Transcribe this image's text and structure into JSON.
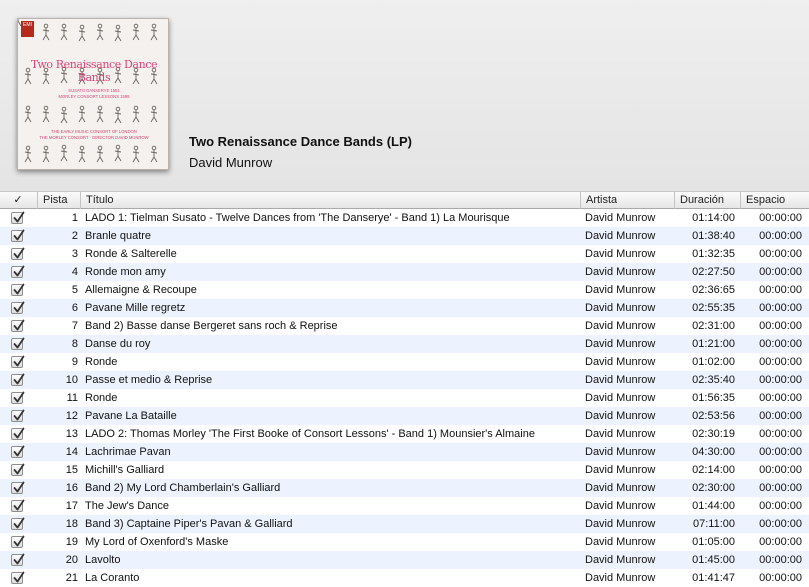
{
  "album": {
    "title": "Two Renaissance Dance Bands (LP)",
    "artist": "David Munrow",
    "cover": {
      "logo": "EMI",
      "title": "Two Renaissance Dance Bands",
      "credit_line_1": "SUSATO DANSERYE 1551",
      "credit_line_2": "MORLEY CONSORT LESSONS 1599",
      "credit_line_3": "THE EARLY MUSIC CONSORT OF LONDON",
      "credit_line_4": "THE MORLEY CONSORT · DIRECTOR DAVID MUNROW"
    }
  },
  "columns": {
    "check": "✓",
    "track": "Pista",
    "title": "Título",
    "artist": "Artista",
    "duration": "Duración",
    "space": "Espacio"
  },
  "tracks": [
    {
      "num": "1",
      "title": "LADO 1: Tielman Susato - Twelve Dances from 'The Danserye' - Band 1) La Mourisque",
      "artist": "David Munrow",
      "duration": "01:14:00",
      "space": "00:00:00",
      "checked": true
    },
    {
      "num": "2",
      "title": "Branle quatre",
      "artist": "David Munrow",
      "duration": "01:38:40",
      "space": "00:00:00",
      "checked": true
    },
    {
      "num": "3",
      "title": "Ronde & Salterelle",
      "artist": "David Munrow",
      "duration": "01:32:35",
      "space": "00:00:00",
      "checked": true
    },
    {
      "num": "4",
      "title": "Ronde mon amy",
      "artist": "David Munrow",
      "duration": "02:27:50",
      "space": "00:00:00",
      "checked": true
    },
    {
      "num": "5",
      "title": "Allemaigne & Recoupe",
      "artist": "David Munrow",
      "duration": "02:36:65",
      "space": "00:00:00",
      "checked": true
    },
    {
      "num": "6",
      "title": "Pavane Mille regretz",
      "artist": "David Munrow",
      "duration": "02:55:35",
      "space": "00:00:00",
      "checked": true
    },
    {
      "num": "7",
      "title": "Band 2) Basse danse Bergeret sans roch & Reprise",
      "artist": "David Munrow",
      "duration": "02:31:00",
      "space": "00:00:00",
      "checked": true
    },
    {
      "num": "8",
      "title": "Danse du roy",
      "artist": "David Munrow",
      "duration": "01:21:00",
      "space": "00:00:00",
      "checked": true
    },
    {
      "num": "9",
      "title": "Ronde",
      "artist": "David Munrow",
      "duration": "01:02:00",
      "space": "00:00:00",
      "checked": true
    },
    {
      "num": "10",
      "title": "Passe et medio & Reprise",
      "artist": "David Munrow",
      "duration": "02:35:40",
      "space": "00:00:00",
      "checked": true
    },
    {
      "num": "11",
      "title": "Ronde",
      "artist": "David Munrow",
      "duration": "01:56:35",
      "space": "00:00:00",
      "checked": true
    },
    {
      "num": "12",
      "title": "Pavane La Bataille",
      "artist": "David Munrow",
      "duration": "02:53:56",
      "space": "00:00:00",
      "checked": true
    },
    {
      "num": "13",
      "title": "LADO 2: Thomas Morley 'The First Booke of Consort Lessons' - Band 1) Mounsier's Almaine",
      "artist": "David Munrow",
      "duration": "02:30:19",
      "space": "00:00:00",
      "checked": true
    },
    {
      "num": "14",
      "title": "Lachrimae Pavan",
      "artist": "David Munrow",
      "duration": "04:30:00",
      "space": "00:00:00",
      "checked": true
    },
    {
      "num": "15",
      "title": "Michill's Galliard",
      "artist": "David Munrow",
      "duration": "02:14:00",
      "space": "00:00:00",
      "checked": true
    },
    {
      "num": "16",
      "title": "Band 2) My Lord Chamberlain's Galliard",
      "artist": "David Munrow",
      "duration": "02:30:00",
      "space": "00:00:00",
      "checked": true
    },
    {
      "num": "17",
      "title": "The Jew's Dance",
      "artist": "David Munrow",
      "duration": "01:44:00",
      "space": "00:00:00",
      "checked": true
    },
    {
      "num": "18",
      "title": "Band 3) Captaine Piper's Pavan & Galliard",
      "artist": "David Munrow",
      "duration": "07:11:00",
      "space": "00:00:00",
      "checked": true
    },
    {
      "num": "19",
      "title": "My Lord of Oxenford's Maske",
      "artist": "David Munrow",
      "duration": "01:05:00",
      "space": "00:00:00",
      "checked": true
    },
    {
      "num": "20",
      "title": "Lavolto",
      "artist": "David Munrow",
      "duration": "01:45:00",
      "space": "00:00:00",
      "checked": true
    },
    {
      "num": "21",
      "title": "La Coranto",
      "artist": "David Munrow",
      "duration": "01:41:47",
      "space": "00:00:00",
      "checked": true
    }
  ]
}
